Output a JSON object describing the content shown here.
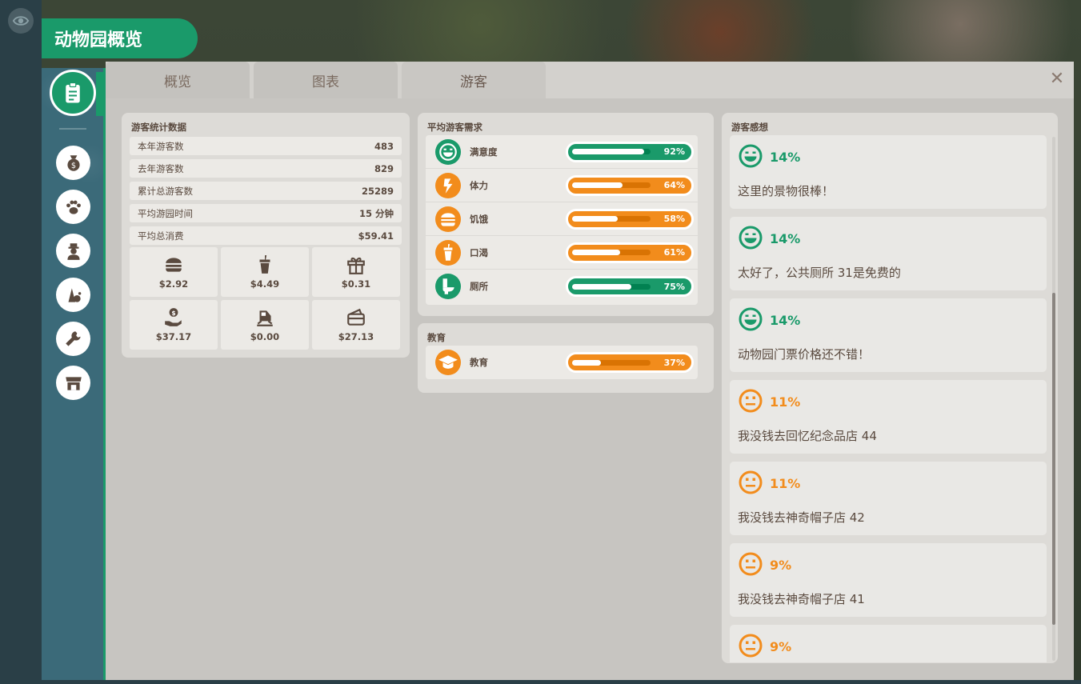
{
  "header": {
    "title": "动物园概览"
  },
  "tabs": [
    {
      "label": "概览",
      "active": false
    },
    {
      "label": "图表",
      "active": false
    },
    {
      "label": "游客",
      "active": true
    }
  ],
  "close_icon": "close-icon",
  "sidebar": {
    "items": [
      {
        "icon": "clipboard-icon",
        "active": true
      },
      {
        "icon": "money-bag-icon"
      },
      {
        "icon": "paw-icon"
      },
      {
        "icon": "staff-icon"
      },
      {
        "icon": "habitat-icon"
      },
      {
        "icon": "wrench-icon"
      },
      {
        "icon": "shop-icon"
      }
    ]
  },
  "visitor_stats": {
    "title": "游客统计数据",
    "rows": [
      {
        "label": "本年游客数",
        "value": "483"
      },
      {
        "label": "去年游客数",
        "value": "829"
      },
      {
        "label": "累计总游客数",
        "value": "25289"
      },
      {
        "label": "平均游园时间",
        "value": "15 分钟"
      },
      {
        "label": "平均总消费",
        "value": "$59.41"
      }
    ],
    "spending": [
      {
        "icon": "burger-icon",
        "value": "$2.92"
      },
      {
        "icon": "drink-icon",
        "value": "$4.49"
      },
      {
        "icon": "gift-icon",
        "value": "$0.31"
      },
      {
        "icon": "donation-icon",
        "value": "$37.17"
      },
      {
        "icon": "train-icon",
        "value": "$0.00"
      },
      {
        "icon": "ticket-icon",
        "value": "$27.13"
      }
    ]
  },
  "needs": {
    "title": "平均游客需求",
    "items": [
      {
        "label": "满意度",
        "icon": "happy-face-icon",
        "pct": "92%",
        "value": 0.92,
        "color": "#1a9a6a"
      },
      {
        "label": "体力",
        "icon": "energy-icon",
        "pct": "64%",
        "value": 0.64,
        "color": "#f28c1c"
      },
      {
        "label": "饥饿",
        "icon": "burger-icon",
        "pct": "58%",
        "value": 0.58,
        "color": "#f28c1c"
      },
      {
        "label": "口渴",
        "icon": "drink-icon",
        "pct": "61%",
        "value": 0.61,
        "color": "#f28c1c"
      },
      {
        "label": "厕所",
        "icon": "toilet-icon",
        "pct": "75%",
        "value": 0.75,
        "color": "#1a9a6a"
      }
    ]
  },
  "education": {
    "title": "教育",
    "items": [
      {
        "label": "教育",
        "icon": "graduation-cap-icon",
        "pct": "37%",
        "value": 0.37,
        "color": "#f28c1c"
      }
    ]
  },
  "thoughts": {
    "title": "游客感想",
    "items": [
      {
        "pct": "14%",
        "message": "这里的景物很棒！",
        "mood": "happy",
        "color": "#1a9a6a"
      },
      {
        "pct": "14%",
        "message": "太好了，公共厕所 31是免费的",
        "mood": "happy",
        "color": "#1a9a6a"
      },
      {
        "pct": "14%",
        "message": "动物园门票价格还不错！",
        "mood": "happy",
        "color": "#1a9a6a"
      },
      {
        "pct": "11%",
        "message": "我没钱去回忆纪念品店 44",
        "mood": "neutral",
        "color": "#f28c1c"
      },
      {
        "pct": "11%",
        "message": "我没钱去神奇帽子店 42",
        "mood": "neutral",
        "color": "#f28c1c"
      },
      {
        "pct": "9%",
        "message": "我没钱去神奇帽子店 41",
        "mood": "neutral",
        "color": "#f28c1c"
      },
      {
        "pct": "9%",
        "message": "",
        "mood": "neutral",
        "color": "#f28c1c"
      }
    ]
  }
}
